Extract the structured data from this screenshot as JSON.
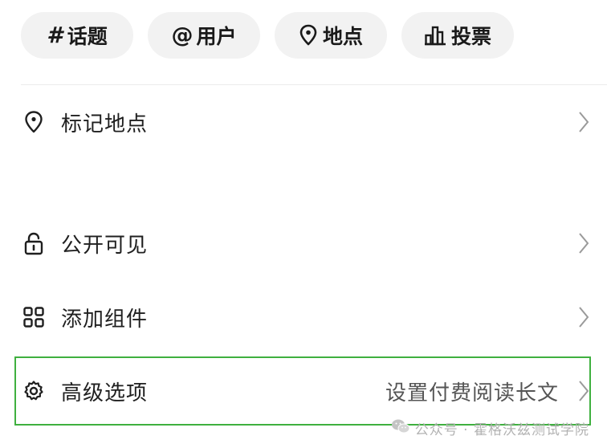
{
  "chips": [
    {
      "label": "话题",
      "icon": "hashtag-icon",
      "glyph": "#"
    },
    {
      "label": "用户",
      "icon": "at-icon",
      "glyph": "@"
    },
    {
      "label": "地点",
      "icon": "location-pin-icon"
    },
    {
      "label": "投票",
      "icon": "bar-chart-icon"
    }
  ],
  "rows": {
    "location": {
      "label": "标记地点",
      "icon": "location-pin-icon"
    },
    "visibility": {
      "label": "公开可见",
      "icon": "lock-open-icon"
    },
    "components": {
      "label": "添加组件",
      "icon": "grid-icon"
    },
    "advanced": {
      "label": "高级选项",
      "value": "设置付费阅读长文",
      "icon": "gear-icon"
    }
  },
  "watermark": {
    "text": "公众号 · 霍格沃兹测试学院",
    "icon": "wechat-icon"
  },
  "colors": {
    "chip_bg": "#f2f2f2",
    "highlight_border": "#3fb03f",
    "text": "#1f1f1f",
    "secondary_text": "#555555",
    "chevron": "#9a9a9a"
  }
}
